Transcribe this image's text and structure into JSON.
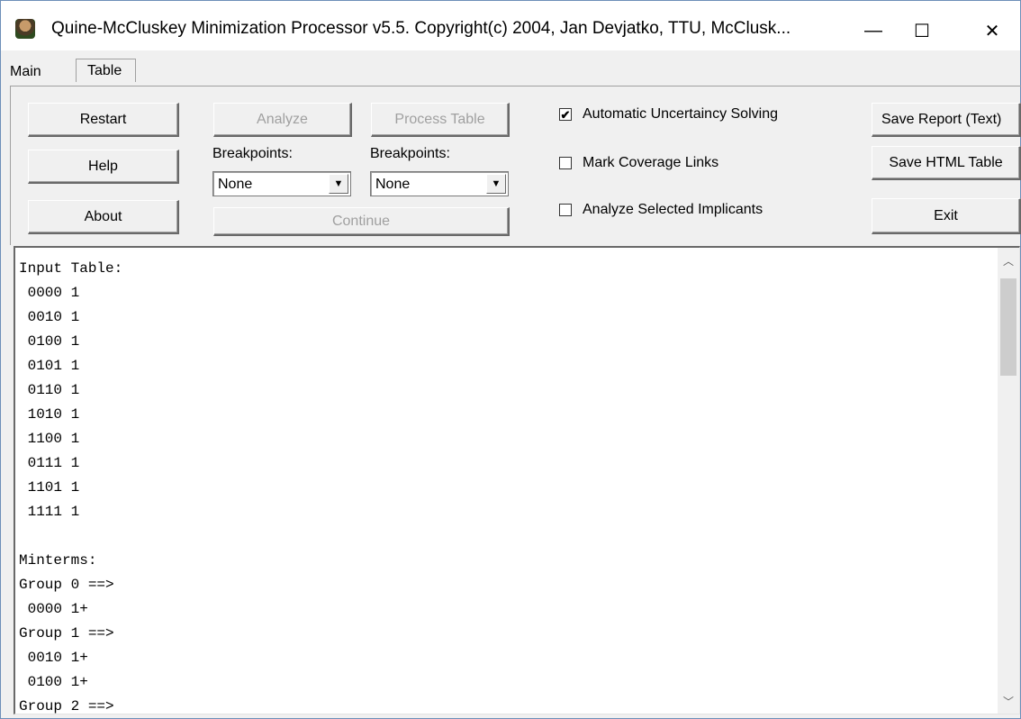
{
  "window": {
    "title": "Quine-McCluskey Minimization Processor v5.5. Copyright(c) 2004, Jan Devjatko, TTU, McClusk...",
    "minimize_glyph": "—",
    "maximize_glyph": "☐",
    "close_glyph": "✕"
  },
  "tabs": [
    {
      "label": "Main"
    },
    {
      "label": "Table"
    }
  ],
  "buttons": {
    "restart": "Restart",
    "help": "Help",
    "about": "About",
    "analyze": "Analyze",
    "process_table": "Process Table",
    "continue": "Continue",
    "save_report": "Save Report (Text)",
    "save_html": "Save HTML Table",
    "exit": "Exit"
  },
  "breakpoints": {
    "label1": "Breakpoints:",
    "value1": "None",
    "label2": "Breakpoints:",
    "value2": "None"
  },
  "checkboxes": [
    {
      "label": "Automatic Uncertaincy Solving",
      "checked": true
    },
    {
      "label": "Mark Coverage Links",
      "checked": false
    },
    {
      "label": "Analyze Selected Implicants",
      "checked": false
    }
  ],
  "output": {
    "lines": [
      "Input Table:",
      " 0000 1",
      " 0010 1",
      " 0100 1",
      " 0101 1",
      " 0110 1",
      " 1010 1",
      " 1100 1",
      " 0111 1",
      " 1101 1",
      " 1111 1",
      "",
      "Minterms:",
      "Group 0 ==>",
      " 0000 1+",
      "Group 1 ==>",
      " 0010 1+",
      " 0100 1+",
      "Group 2 ==>"
    ]
  },
  "icons": {
    "app": "app-portrait-icon",
    "scroll_up": "scroll-up-arrow-icon",
    "scroll_down": "scroll-down-arrow-icon",
    "dropdown": "dropdown-arrow-icon"
  }
}
